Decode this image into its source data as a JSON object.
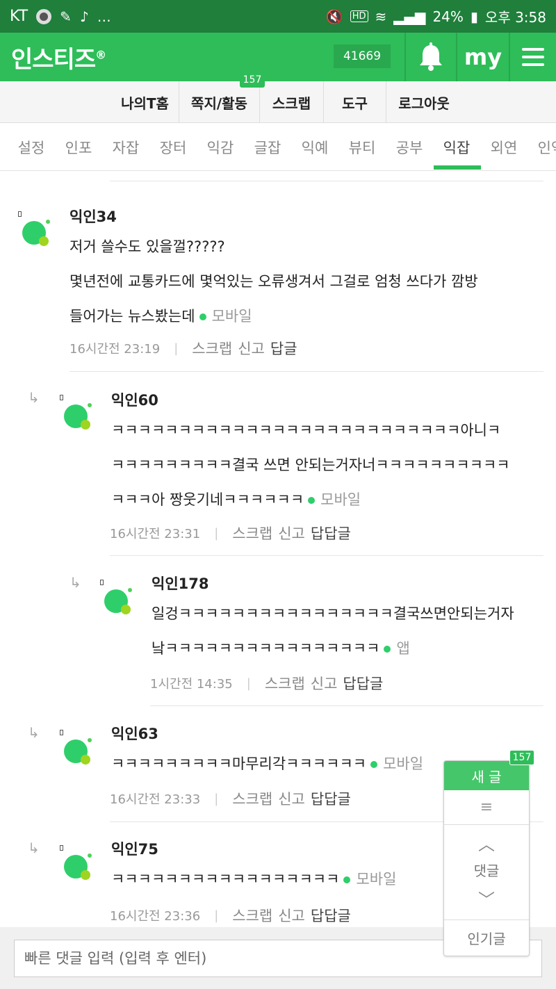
{
  "status_bar": {
    "carrier": "KT",
    "battery": "24%",
    "time": "오후 3:58"
  },
  "header": {
    "logo": "인스티즈",
    "logo_mark": "®",
    "count": "41669",
    "my_label": "my"
  },
  "submenu": {
    "items": [
      "나의T홈",
      "쪽지/활동",
      "스크랩",
      "도구",
      "로그아웃"
    ],
    "badge": "157"
  },
  "categories": [
    "설정",
    "인포",
    "자잡",
    "장터",
    "익감",
    "글잡",
    "익예",
    "뷰티",
    "공부",
    "익잡",
    "외연",
    "인역"
  ],
  "active_category": "익잡",
  "comments": [
    {
      "nick": "익인34",
      "lines": [
        "저거 쓸수도 있을껄?????",
        "몇년전에 교통카드에 몇억있는 오류생겨서 그걸로 엄청 쓰다가 깜방",
        "들어가는 뉴스봤는데"
      ],
      "device": "모바일",
      "time": "16시간전 23:19",
      "scrap": "스크랩",
      "report": "신고",
      "reply": "답글"
    },
    {
      "nick": "익인60",
      "lines": [
        "ㅋㅋㅋㅋㅋㅋㅋㅋㅋㅋㅋㅋㅋㅋㅋㅋㅋㅋㅋㅋㅋㅋㅋㅋㅋㅋ아니ㅋ",
        "ㅋㅋㅋㅋㅋㅋㅋㅋㅋ결국 쓰면 안되는거자너ㅋㅋㅋㅋㅋㅋㅋㅋㅋㅋ",
        "ㅋㅋㅋ아 짱웃기네ㅋㅋㅋㅋㅋㅋ"
      ],
      "device": "모바일",
      "time": "16시간전 23:31",
      "scrap": "스크랩",
      "report": "신고",
      "reply": "답답글"
    },
    {
      "nick": "익인178",
      "lines": [
        "일겅ㅋㅋㅋㅋㅋㅋㅋㅋㅋㅋㅋㅋㅋㅋㅋㅋ결국쓰면안되는거자",
        "낰ㅋㅋㅋㅋㅋㅋㅋㅋㅋㅋㅋㅋㅋㅋㅋㅋ"
      ],
      "device": "앱",
      "time": "1시간전 14:35",
      "scrap": "스크랩",
      "report": "신고",
      "reply": "답답글"
    },
    {
      "nick": "익인63",
      "lines": [
        "ㅋㅋㅋㅋㅋㅋㅋㅋㅋ마무리각ㅋㅋㅋㅋㅋㅋ"
      ],
      "device": "모바일",
      "time": "16시간전 23:33",
      "scrap": "스크랩",
      "report": "신고",
      "reply": "답답글"
    },
    {
      "nick": "익인75",
      "lines": [
        "ㅋㅋㅋㅋㅋㅋㅋㅋㅋㅋㅋㅋㅋㅋㅋㅋㅋ"
      ],
      "device": "모바일",
      "time": "16시간전 23:36",
      "scrap": "스크랩",
      "report": "신고",
      "reply": "답답글"
    }
  ],
  "floating": {
    "new_post": "새 글",
    "badge": "157",
    "comments": "댓글",
    "popular": "인기글"
  },
  "input": {
    "placeholder": "빠른 댓글 입력 (입력 후 엔터)"
  }
}
